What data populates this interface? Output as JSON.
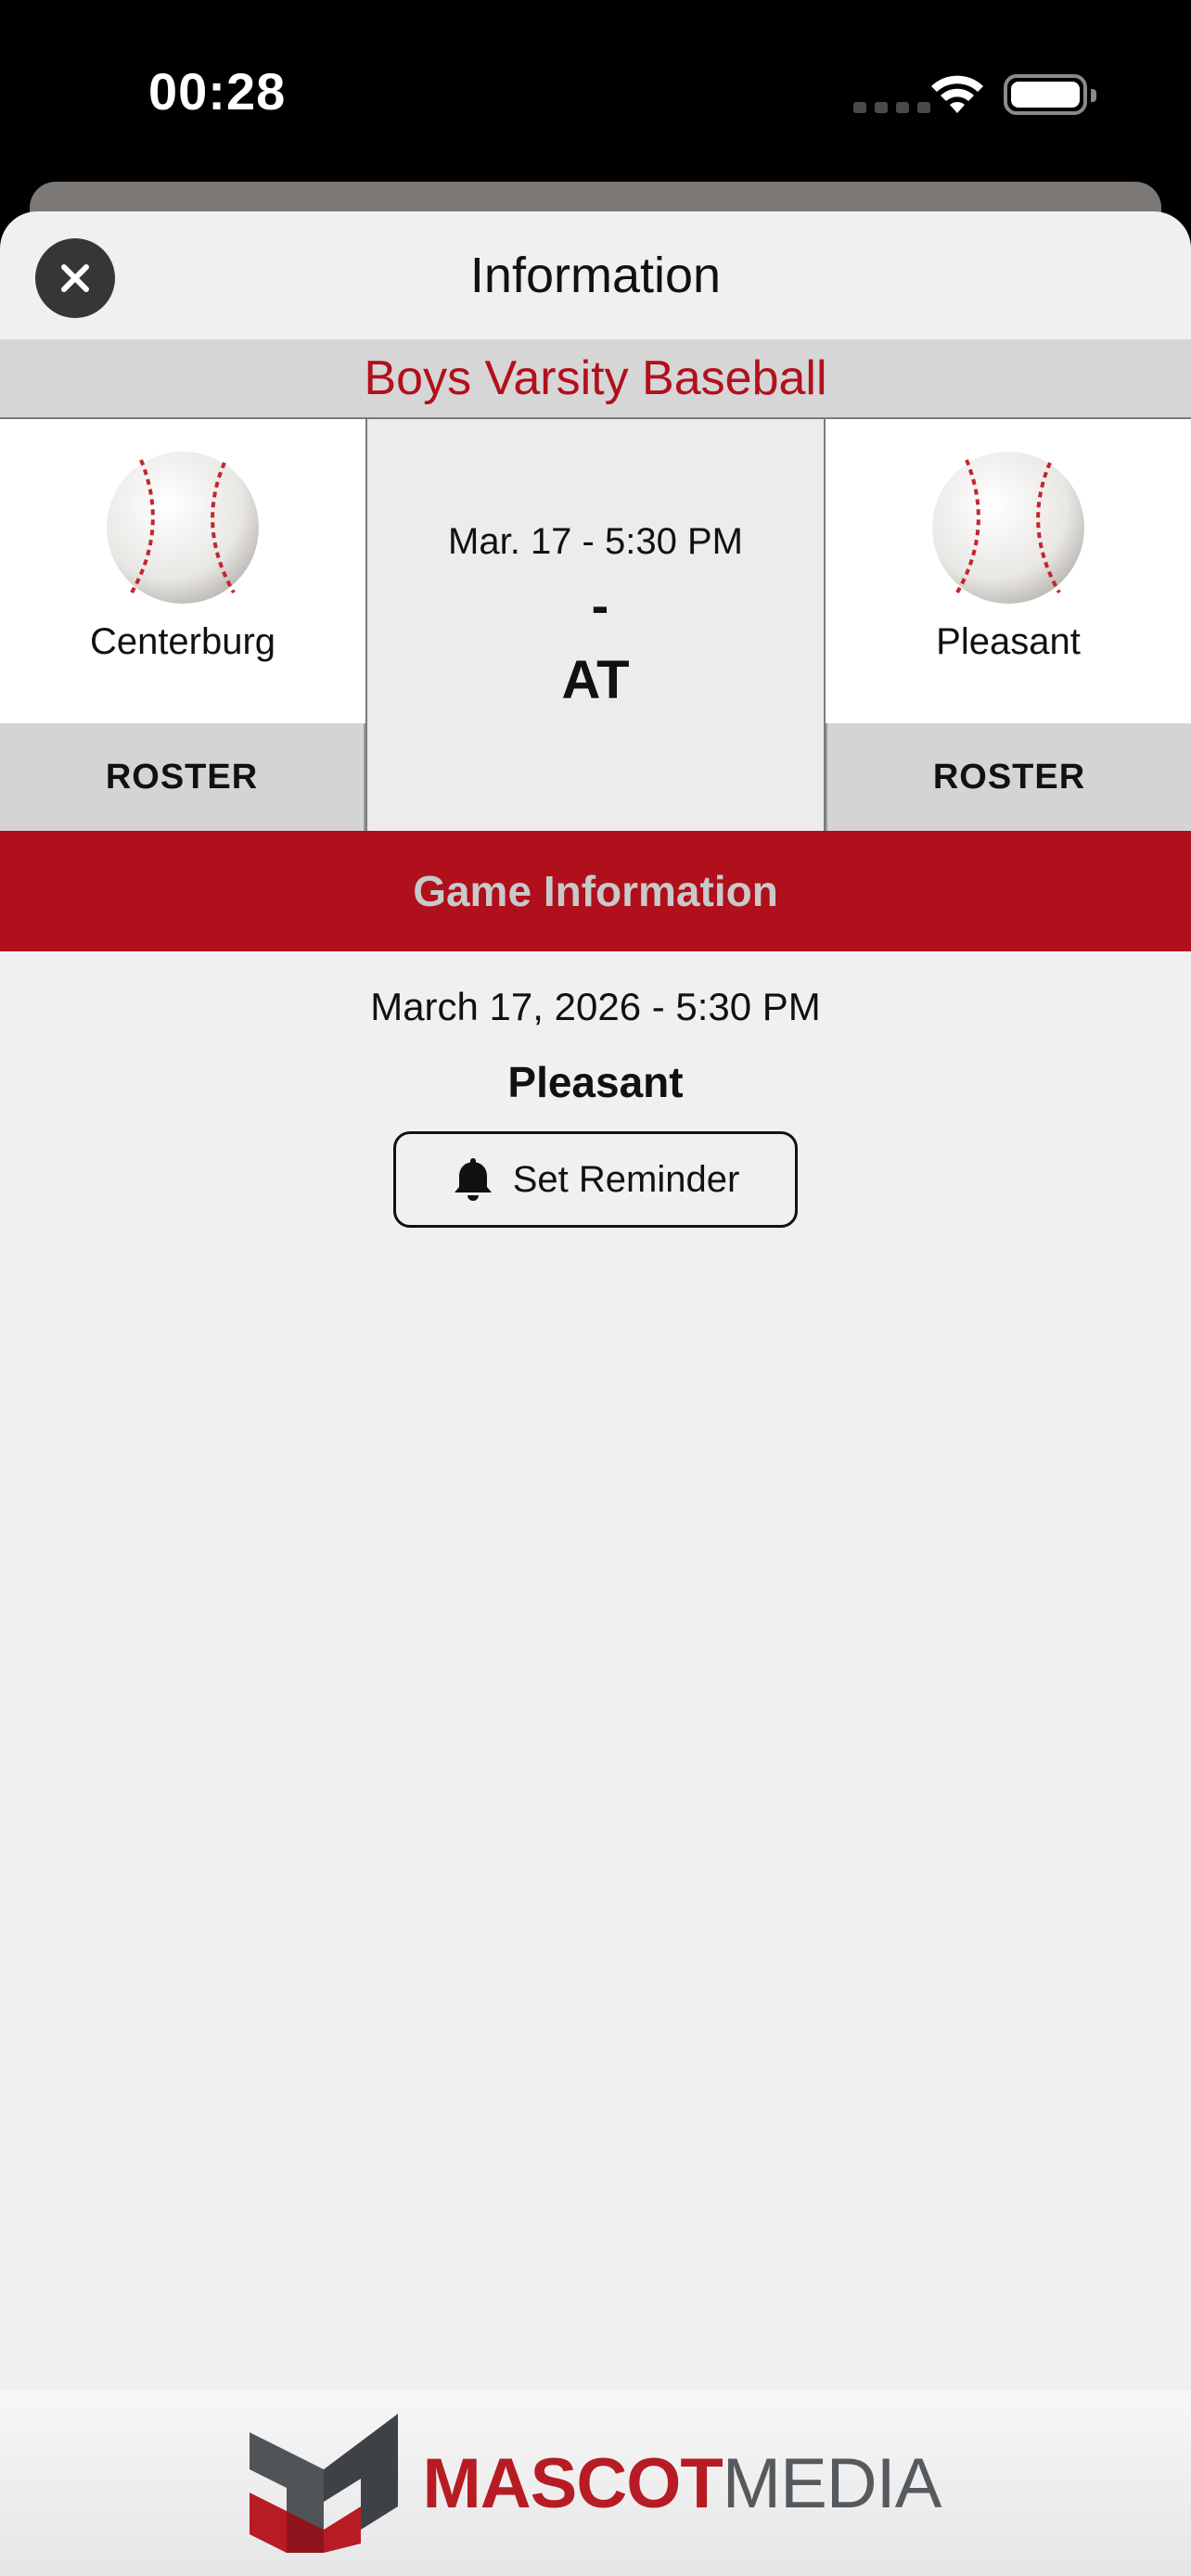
{
  "status_bar": {
    "time": "00:28"
  },
  "header": {
    "title": "Information",
    "close_icon": "close-icon"
  },
  "sport": {
    "title": "Boys Varsity Baseball",
    "accent_color": "#b30f1c"
  },
  "teams": {
    "left": {
      "name": "Centerburg",
      "roster_label": "ROSTER",
      "icon": "baseball-icon"
    },
    "right": {
      "name": "Pleasant",
      "roster_label": "ROSTER",
      "icon": "baseball-icon"
    }
  },
  "matchup": {
    "date": "Mar. 17 - 5:30 PM",
    "score": "-",
    "versus": "AT"
  },
  "game_info": {
    "title": "Game Information",
    "full_date": "March 17, 2026 - 5:30 PM",
    "venue": "Pleasant",
    "reminder_label": "Set Reminder",
    "reminder_icon": "bell-icon",
    "bar_color": "#b00f1c"
  },
  "footer": {
    "logo_part1": "MASCOT",
    "logo_part2": "MEDIA"
  }
}
